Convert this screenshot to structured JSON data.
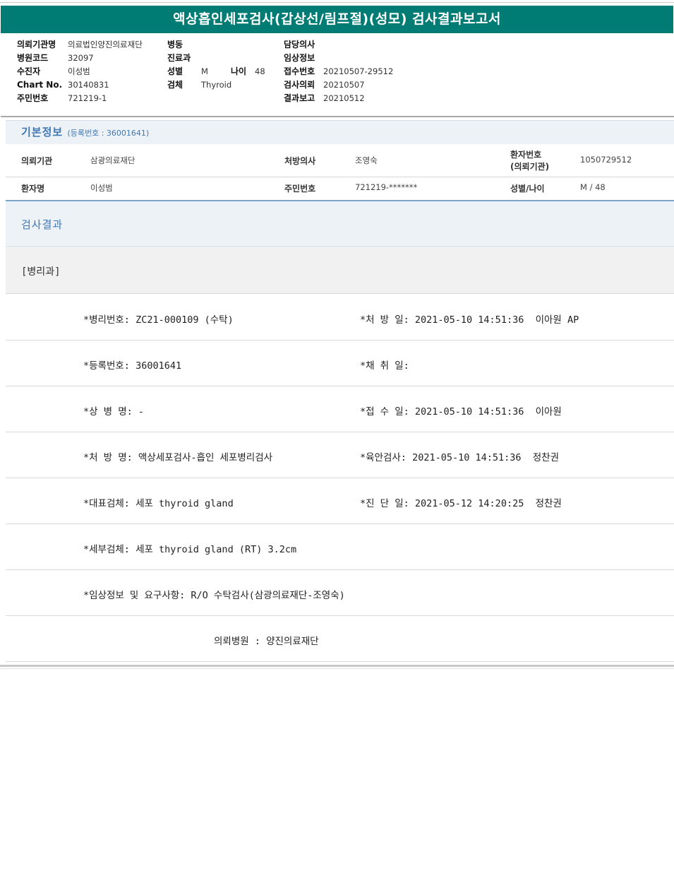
{
  "report": {
    "title": "액상흡인세포검사(갑상선/림프절)(성모) 검사결과보고서"
  },
  "header": {
    "col1": [
      {
        "label": "의뢰기관명",
        "value": "의료법인양진의료재단"
      },
      {
        "label": "병원코드",
        "value": "32097"
      },
      {
        "label": "수진자",
        "value": "이성범"
      },
      {
        "label": "Chart No.",
        "value": "30140831"
      },
      {
        "label": "주민번호",
        "value": "721219-1"
      }
    ],
    "col2": [
      {
        "label": "병동",
        "value": ""
      },
      {
        "label": "진료과",
        "value": ""
      },
      {
        "label": "성별",
        "value": "M",
        "label2": "나이",
        "value2": "48"
      },
      {
        "label": "검체",
        "value": "Thyroid"
      }
    ],
    "col3": [
      {
        "label": "담당의사",
        "value": ""
      },
      {
        "label": "임상정보",
        "value": ""
      },
      {
        "label": "접수번호",
        "value": "20210507-29512"
      },
      {
        "label": "검사의뢰",
        "value": "20210507"
      },
      {
        "label": "결과보고",
        "value": "20210512"
      }
    ]
  },
  "basic_info": {
    "title": "기본정보",
    "reg_text": "(등록번호 : 36001641)",
    "row1": {
      "k1": "의뢰기관",
      "v1": "삼광의료재단",
      "k2": "처방의사",
      "v2": "조영숙",
      "k3a": "환자번호",
      "k3b": "(의뢰기관)",
      "v3": "1050729512"
    },
    "row2": {
      "k1": "환자명",
      "v1": "이성범",
      "k2": "주민번호",
      "v2": "721219-*******",
      "k3": "성별/나이",
      "v3": "M / 48"
    }
  },
  "results": {
    "title": "검사결과",
    "department": "[병리과]",
    "rows": [
      {
        "left": "*병리번호: ZC21-000109 (수탁)",
        "right": "*처 방 일: 2021-05-10 14:51:36  이아원 AP"
      },
      {
        "left": "*등록번호: 36001641",
        "right": "*채 취 일:"
      },
      {
        "left": "*상 병 명: -",
        "right": "*접 수 일: 2021-05-10 14:51:36  이아원"
      },
      {
        "left": "*처 방 명: 액상세포검사-흡인 세포병리검사",
        "right": "*육안검사: 2021-05-10 14:51:36  정찬권"
      },
      {
        "left": "*대표검체: 세포 thyroid gland",
        "right": "*진 단 일: 2021-05-12 14:20:25  정찬권"
      },
      {
        "left": "*세부검체: 세포 thyroid gland (RT) 3.2cm",
        "right": ""
      },
      {
        "left": "*임상정보 및 요구사항: R/O 수탁검사(삼광의료재단-조영숙)",
        "right": ""
      }
    ],
    "referral": "의뢰병원 : 양진의료재단"
  }
}
